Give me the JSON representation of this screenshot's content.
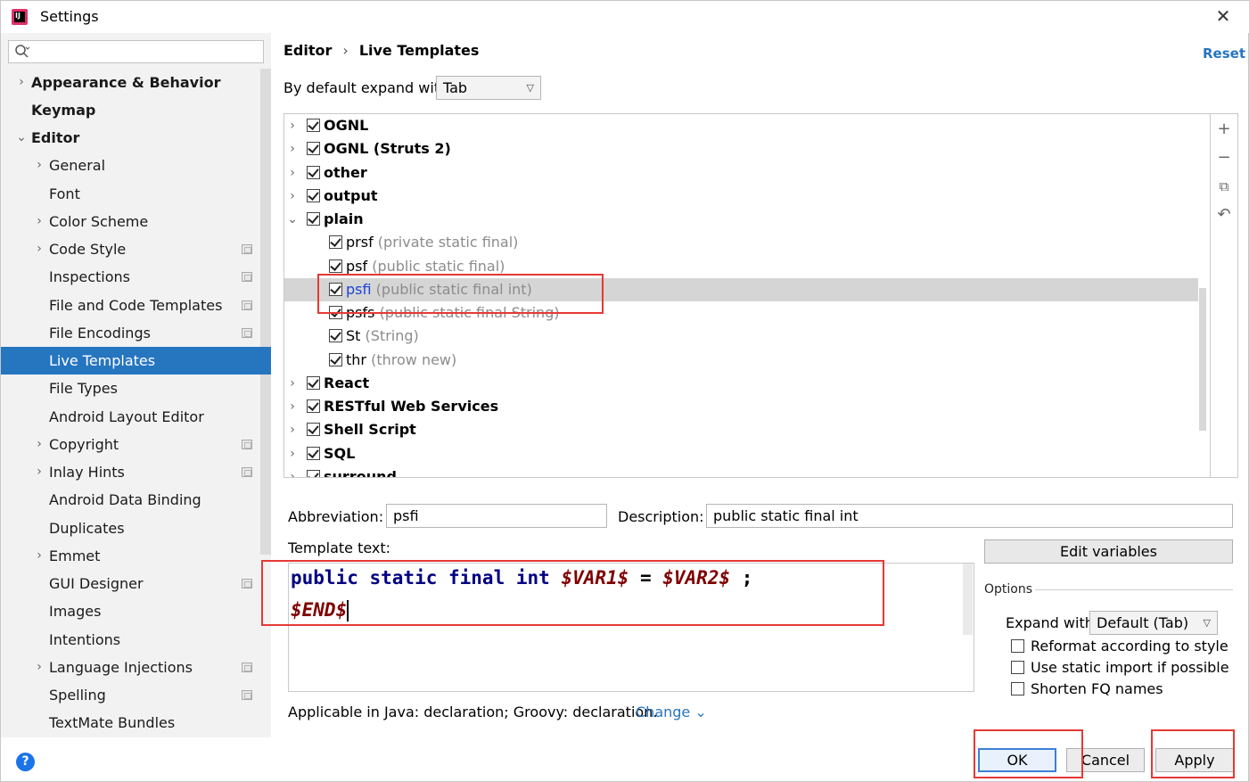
{
  "window": {
    "title": "Settings",
    "close_glyph": "✕"
  },
  "search": {
    "placeholder": ""
  },
  "sidebar": {
    "items": [
      {
        "label": "Appearance & Behavior",
        "chevron": "›",
        "level": 0,
        "bold": true,
        "selected": false,
        "project_icon": false
      },
      {
        "label": "Keymap",
        "chevron": "",
        "level": 0,
        "bold": true,
        "selected": false,
        "project_icon": false
      },
      {
        "label": "Editor",
        "chevron": "⌄",
        "level": 0,
        "bold": true,
        "selected": false,
        "project_icon": false
      },
      {
        "label": "General",
        "chevron": "›",
        "level": 1,
        "bold": false,
        "selected": false,
        "project_icon": false
      },
      {
        "label": "Font",
        "chevron": "",
        "level": 1,
        "bold": false,
        "selected": false,
        "project_icon": false
      },
      {
        "label": "Color Scheme",
        "chevron": "›",
        "level": 1,
        "bold": false,
        "selected": false,
        "project_icon": false
      },
      {
        "label": "Code Style",
        "chevron": "›",
        "level": 1,
        "bold": false,
        "selected": false,
        "project_icon": true
      },
      {
        "label": "Inspections",
        "chevron": "",
        "level": 1,
        "bold": false,
        "selected": false,
        "project_icon": true
      },
      {
        "label": "File and Code Templates",
        "chevron": "",
        "level": 1,
        "bold": false,
        "selected": false,
        "project_icon": true
      },
      {
        "label": "File Encodings",
        "chevron": "",
        "level": 1,
        "bold": false,
        "selected": false,
        "project_icon": true
      },
      {
        "label": "Live Templates",
        "chevron": "",
        "level": 1,
        "bold": false,
        "selected": true,
        "project_icon": false
      },
      {
        "label": "File Types",
        "chevron": "",
        "level": 1,
        "bold": false,
        "selected": false,
        "project_icon": false
      },
      {
        "label": "Android Layout Editor",
        "chevron": "",
        "level": 1,
        "bold": false,
        "selected": false,
        "project_icon": false
      },
      {
        "label": "Copyright",
        "chevron": "›",
        "level": 1,
        "bold": false,
        "selected": false,
        "project_icon": true
      },
      {
        "label": "Inlay Hints",
        "chevron": "›",
        "level": 1,
        "bold": false,
        "selected": false,
        "project_icon": true
      },
      {
        "label": "Android Data Binding",
        "chevron": "",
        "level": 1,
        "bold": false,
        "selected": false,
        "project_icon": false
      },
      {
        "label": "Duplicates",
        "chevron": "",
        "level": 1,
        "bold": false,
        "selected": false,
        "project_icon": false
      },
      {
        "label": "Emmet",
        "chevron": "›",
        "level": 1,
        "bold": false,
        "selected": false,
        "project_icon": false
      },
      {
        "label": "GUI Designer",
        "chevron": "",
        "level": 1,
        "bold": false,
        "selected": false,
        "project_icon": true
      },
      {
        "label": "Images",
        "chevron": "",
        "level": 1,
        "bold": false,
        "selected": false,
        "project_icon": false
      },
      {
        "label": "Intentions",
        "chevron": "",
        "level": 1,
        "bold": false,
        "selected": false,
        "project_icon": false
      },
      {
        "label": "Language Injections",
        "chevron": "›",
        "level": 1,
        "bold": false,
        "selected": false,
        "project_icon": true
      },
      {
        "label": "Spelling",
        "chevron": "",
        "level": 1,
        "bold": false,
        "selected": false,
        "project_icon": true
      },
      {
        "label": "TextMate Bundles",
        "chevron": "",
        "level": 1,
        "bold": false,
        "selected": false,
        "project_icon": false
      }
    ]
  },
  "breadcrumb": {
    "parent": "Editor",
    "separator": "›",
    "current": "Live Templates"
  },
  "reset_label": "Reset",
  "expand": {
    "label": "By default expand with",
    "value": "Tab"
  },
  "toolbar": {
    "add": "+",
    "remove": "−",
    "copy": "⧉",
    "restore": "↶"
  },
  "templates": [
    {
      "type": "group",
      "name": "OGNL",
      "desc": "",
      "expanded": false,
      "checked": true,
      "highlighted": false
    },
    {
      "type": "group",
      "name": "OGNL (Struts 2)",
      "desc": "",
      "expanded": false,
      "checked": true,
      "highlighted": false
    },
    {
      "type": "group",
      "name": "other",
      "desc": "",
      "expanded": false,
      "checked": true,
      "highlighted": false
    },
    {
      "type": "group",
      "name": "output",
      "desc": "",
      "expanded": false,
      "checked": true,
      "highlighted": false
    },
    {
      "type": "group",
      "name": "plain",
      "desc": "",
      "expanded": true,
      "checked": true,
      "highlighted": false
    },
    {
      "type": "item",
      "name": "prsf",
      "desc": "(private static final)",
      "checked": true,
      "highlighted": false
    },
    {
      "type": "item",
      "name": "psf",
      "desc": "(public static final)",
      "checked": true,
      "highlighted": false
    },
    {
      "type": "item",
      "name": "psfi",
      "desc": "(public static final int)",
      "checked": true,
      "highlighted": true
    },
    {
      "type": "item",
      "name": "psfs",
      "desc": "(public static final String)",
      "checked": true,
      "highlighted": false
    },
    {
      "type": "item",
      "name": "St",
      "desc": "(String)",
      "checked": true,
      "highlighted": false
    },
    {
      "type": "item",
      "name": "thr",
      "desc": "(throw new)",
      "checked": true,
      "highlighted": false
    },
    {
      "type": "group",
      "name": "React",
      "desc": "",
      "expanded": false,
      "checked": true,
      "highlighted": false
    },
    {
      "type": "group",
      "name": "RESTful Web Services",
      "desc": "",
      "expanded": false,
      "checked": true,
      "highlighted": false
    },
    {
      "type": "group",
      "name": "Shell Script",
      "desc": "",
      "expanded": false,
      "checked": true,
      "highlighted": false
    },
    {
      "type": "group",
      "name": "SQL",
      "desc": "",
      "expanded": false,
      "checked": true,
      "highlighted": false
    },
    {
      "type": "group",
      "name": "surround",
      "desc": "",
      "expanded": false,
      "checked": true,
      "highlighted": false
    }
  ],
  "abbreviation": {
    "label": "Abbreviation:",
    "value": "psfi"
  },
  "description": {
    "label": "Description:",
    "value": "public static final int"
  },
  "template_text": {
    "label": "Template text:",
    "line1": {
      "kw": "public static final int",
      "var1": "$VAR1$",
      "eq": " = ",
      "var2": "$VAR2$",
      "end": " ;"
    },
    "line2": {
      "var": "$END$"
    }
  },
  "edit_variables_label": "Edit variables",
  "options": {
    "title": "Options",
    "expand_with_label": "Expand with",
    "expand_with_value": "Default (Tab)",
    "checkboxes": [
      {
        "label": "Reformat according to style",
        "checked": false
      },
      {
        "label": "Use static import if possible",
        "checked": false
      },
      {
        "label": "Shorten FQ names",
        "checked": false
      }
    ]
  },
  "applicable": {
    "text": "Applicable in Java: declaration; Groovy: declaration.",
    "change_label": "Change ⌄"
  },
  "buttons": {
    "ok": "OK",
    "cancel": "Cancel",
    "apply": "Apply"
  },
  "help_glyph": "?",
  "colors": {
    "accent": "#2675bf",
    "highlight_red": "#e53935",
    "keyword": "#000080",
    "variable": "#7f0000"
  }
}
